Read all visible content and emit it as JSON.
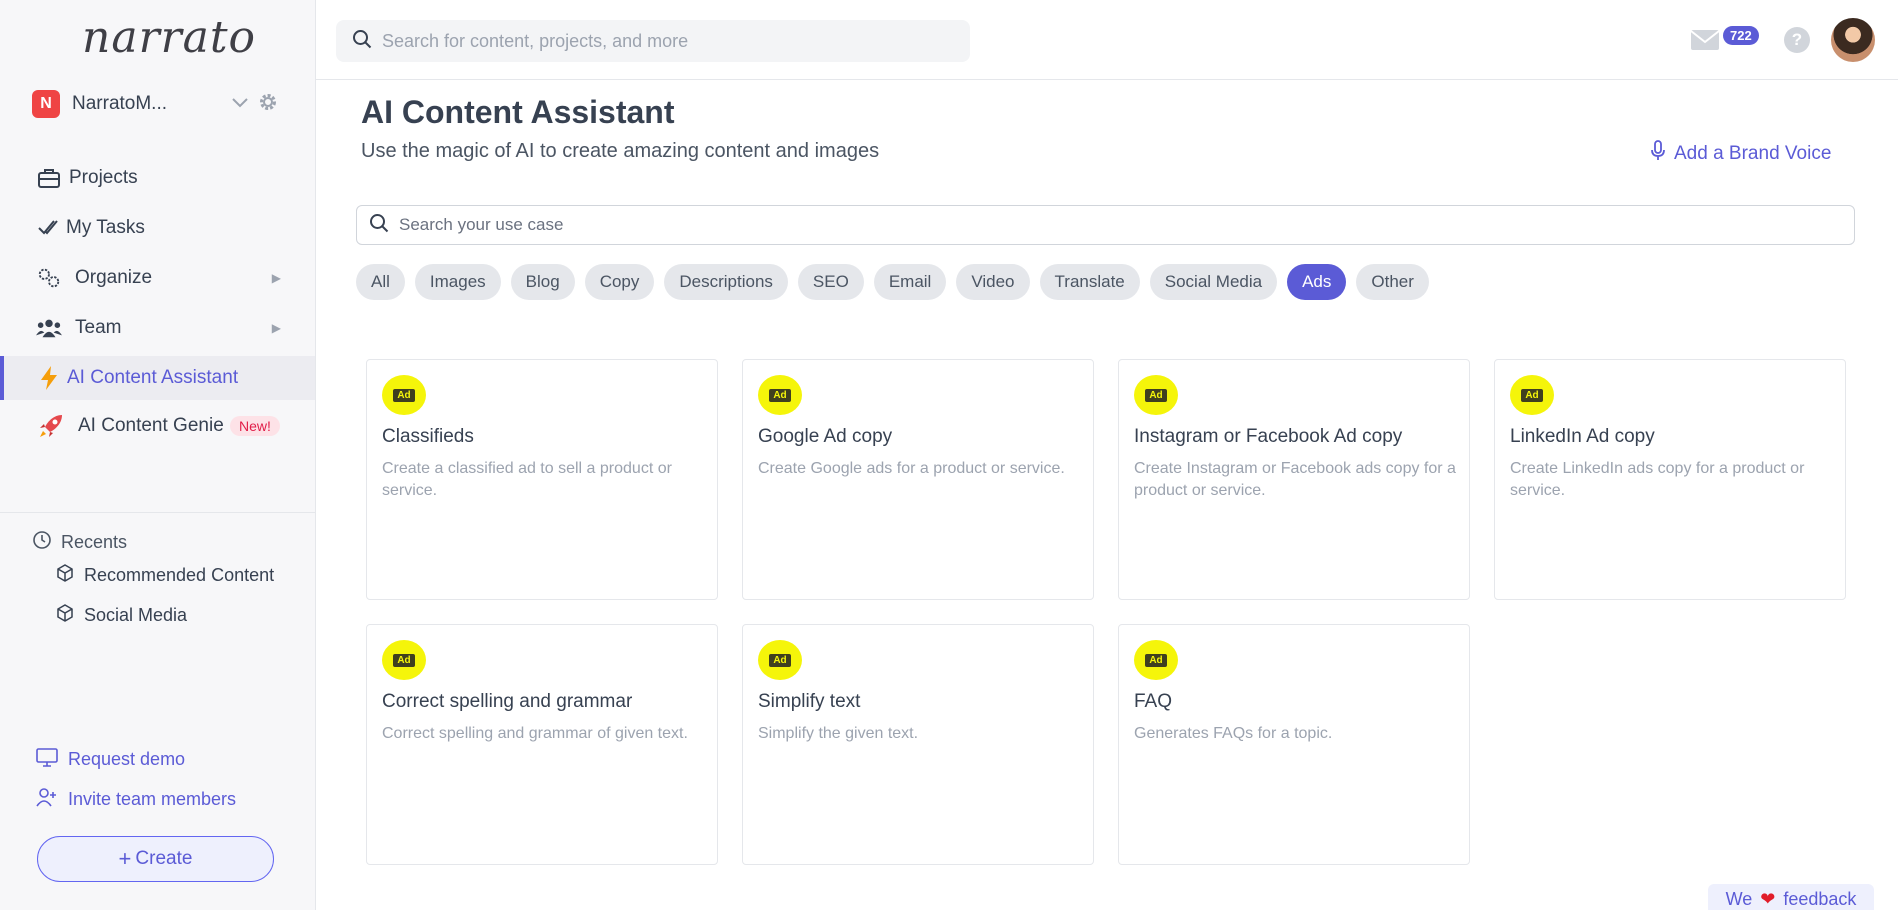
{
  "app": {
    "logo": "narrato"
  },
  "workspace": {
    "initial": "N",
    "name": "NarratoM..."
  },
  "sidebar": {
    "nav": [
      {
        "label": "Projects",
        "icon": "briefcase-icon"
      },
      {
        "label": "My Tasks",
        "icon": "double-check-icon"
      },
      {
        "label": "Organize",
        "icon": "gears-icon"
      },
      {
        "label": "Team",
        "icon": "users-icon"
      },
      {
        "label": "AI Content Assistant",
        "icon": "lightning-icon"
      },
      {
        "label": "AI Content Genie",
        "icon": "rocket-icon",
        "badge": "New!"
      }
    ],
    "recents_title": "Recents",
    "recents": [
      "Recommended Content",
      "Social Media"
    ],
    "request_demo": "Request demo",
    "invite": "Invite team members",
    "create": "Create"
  },
  "topbar": {
    "search_placeholder": "Search for content, projects, and more",
    "mail_count": "722",
    "help": "?"
  },
  "main": {
    "title": "AI Content Assistant",
    "subtitle": "Use the magic of AI to create amazing content and images",
    "brand_voice": "Add a Brand Voice",
    "search_placeholder": "Search your use case",
    "filters": [
      "All",
      "Images",
      "Blog",
      "Copy",
      "Descriptions",
      "SEO",
      "Email",
      "Video",
      "Translate",
      "Social Media",
      "Ads",
      "Other"
    ],
    "active_filter": "Ads",
    "ad_icon_text": "Ad",
    "cards": [
      {
        "title": "Classifieds",
        "desc": "Create a classified ad to sell a product or service."
      },
      {
        "title": "Google Ad copy",
        "desc": "Create Google ads for a product or service."
      },
      {
        "title": "Instagram or Facebook Ad copy",
        "desc": "Create Instagram or Facebook ads copy for a product or service."
      },
      {
        "title": "LinkedIn Ad copy",
        "desc": "Create LinkedIn ads copy for a product or service."
      },
      {
        "title": "Correct spelling and grammar",
        "desc": "Correct spelling and grammar of given text."
      },
      {
        "title": "Simplify text",
        "desc": "Simplify the given text."
      },
      {
        "title": "FAQ",
        "desc": "Generates FAQs for a topic."
      }
    ]
  },
  "feedback": {
    "pre": "We",
    "post": "feedback"
  },
  "colors": {
    "accent": "#5b5bd6",
    "ad_yellow": "#f5f50a",
    "new_badge": "#e11d48"
  }
}
